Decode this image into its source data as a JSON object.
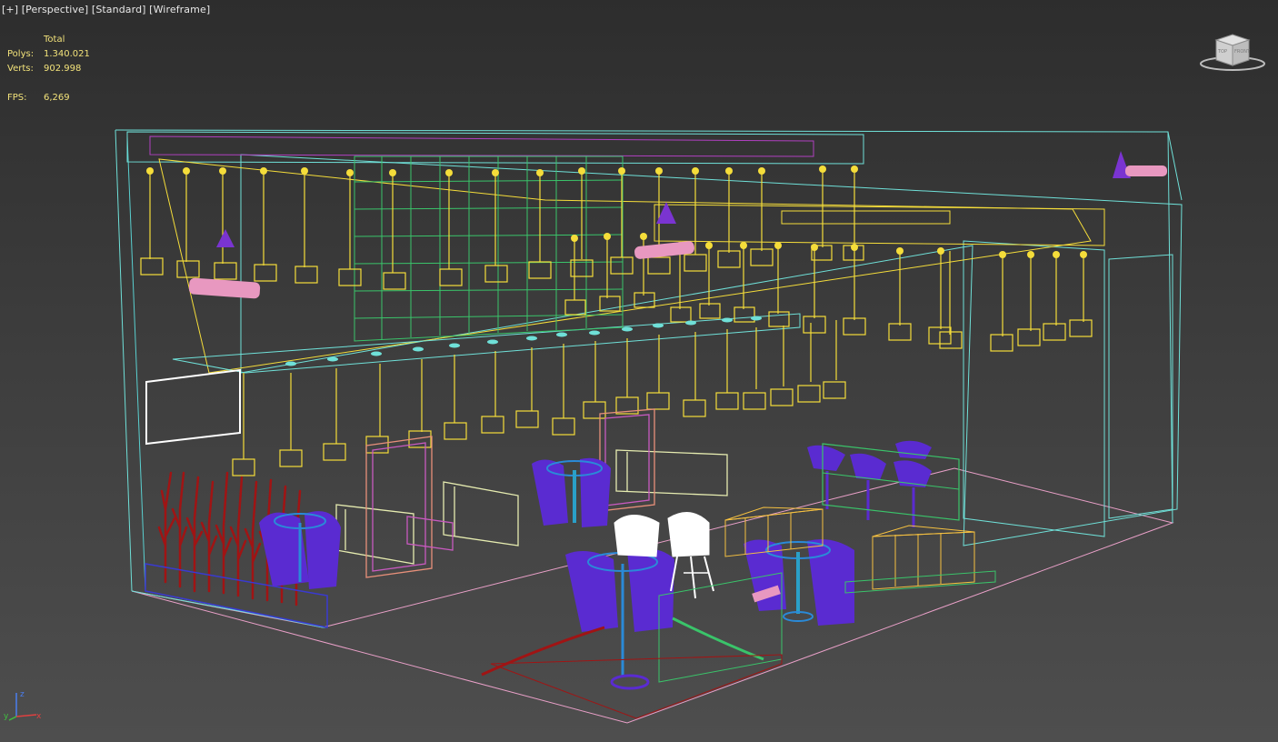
{
  "viewport": {
    "label_items": [
      "[+]",
      "[Perspective]",
      "[Standard]",
      "[Wireframe]"
    ]
  },
  "stats": {
    "header": "Total",
    "polys_label": "Polys:",
    "polys_value": "1.340.021",
    "verts_label": "Verts:",
    "verts_value": "902.998",
    "fps_label": "FPS:",
    "fps_value": "6,269"
  },
  "viewcube": {
    "icon": "viewcube-icon",
    "face_labels": [
      "TOP",
      "FRONT"
    ]
  },
  "axis": {
    "icon": "axis-tripod-icon",
    "labels": [
      "z",
      "y",
      "x"
    ]
  },
  "colors": {
    "viewport_bg": "#3b3b3b",
    "stats_text": "#f2e27a",
    "wire_cyan": "#6fe0d8",
    "wire_yellow": "#f5dd3a",
    "wire_green": "#3ac46a",
    "wire_pink": "#e9a0c8",
    "chair_purple": "#5a2bd1",
    "plant_red": "#a01414",
    "bench_cream": "#e6ecb0",
    "lamp_pink": "#f0a0c8"
  }
}
